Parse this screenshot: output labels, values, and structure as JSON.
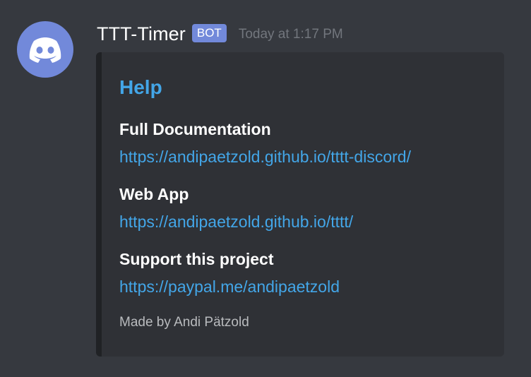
{
  "message": {
    "username": "TTT-Timer",
    "bot_tag": "BOT",
    "timestamp": "Today at 1:17 PM",
    "avatar_icon": "discord-logo-icon"
  },
  "embed": {
    "title": "Help",
    "fields": [
      {
        "name": "Full Documentation",
        "value": "https://andipaetzold.github.io/tttt-discord/"
      },
      {
        "name": "Web App",
        "value": "https://andipaetzold.github.io/tttt/"
      },
      {
        "name": "Support this project",
        "value": "https://paypal.me/andipaetzold"
      }
    ],
    "footer": "Made by Andi Pätzold"
  },
  "colors": {
    "background": "#36393f",
    "embed_background": "#2f3136",
    "embed_border": "#202225",
    "blurple": "#7289da",
    "link": "#43a6e8",
    "muted": "#72767d"
  }
}
